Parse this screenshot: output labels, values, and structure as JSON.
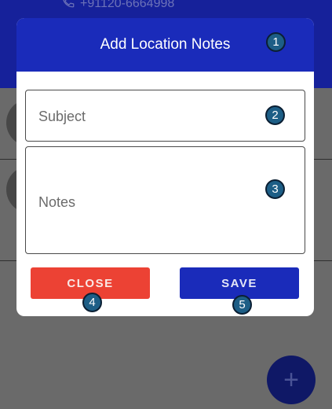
{
  "background": {
    "phone_number": "+91120-6664998",
    "fab_symbol": "+"
  },
  "modal": {
    "title": "Add Location Notes",
    "subject_placeholder": "Subject",
    "notes_placeholder": "Notes",
    "close_label": "CLOSE",
    "save_label": "SAVE"
  },
  "markers": [
    "1",
    "2",
    "3",
    "4",
    "5"
  ],
  "colors": {
    "header_blue": "#1a2bba",
    "close_red": "#ec4234",
    "marker_teal": "#1d5e86"
  }
}
